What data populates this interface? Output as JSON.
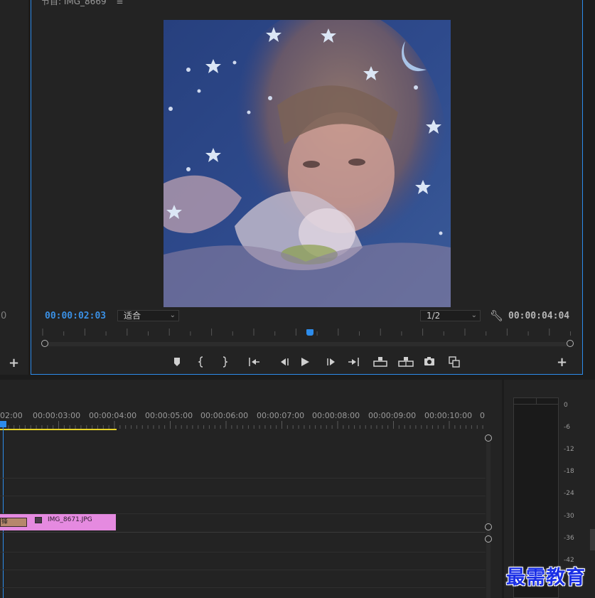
{
  "monitor": {
    "title": "节目: IMG_8669",
    "menu_icon": "hamburger-icon",
    "current_timecode": "00:00:02:03",
    "fit_select": "适合",
    "resolution_select": "1/2",
    "duration_timecode": "00:00:04:04",
    "settings_icon": "wrench-icon",
    "buttons": [
      {
        "name": "add-marker",
        "icon": "marker-icon"
      },
      {
        "name": "mark-in",
        "icon": "mark-in-icon"
      },
      {
        "name": "mark-out",
        "icon": "mark-out-icon"
      },
      {
        "name": "go-to-in",
        "icon": "go-to-in-icon"
      },
      {
        "name": "step-back",
        "icon": "step-back-icon"
      },
      {
        "name": "play",
        "icon": "play-icon"
      },
      {
        "name": "step-forward",
        "icon": "step-forward-icon"
      },
      {
        "name": "go-to-out",
        "icon": "go-to-out-icon"
      },
      {
        "name": "lift",
        "icon": "lift-icon"
      },
      {
        "name": "extract",
        "icon": "extract-icon"
      },
      {
        "name": "export-frame",
        "icon": "camera-icon"
      },
      {
        "name": "comparison-view",
        "icon": "comparison-icon"
      }
    ],
    "playhead_fraction": 0.495
  },
  "left_panel": {
    "edge_value": "0"
  },
  "timeline": {
    "ruler_labels": [
      "02:00",
      "00:00:03:00",
      "00:00:04:00",
      "00:00:05:00",
      "00:00:06:00",
      "00:00:07:00",
      "00:00:08:00",
      "00:00:09:00",
      "00:00:10:00",
      "0"
    ],
    "clip_label": "IMG_8671.JPG",
    "prev_clip_label": "锋"
  },
  "meter": {
    "db_scale": [
      "0",
      "-6",
      "-12",
      "-18",
      "-24",
      "-30",
      "-36",
      "-42"
    ]
  },
  "watermark": "最需教育",
  "colors": {
    "accent": "#2d8ceb",
    "clip": "#e58ae0",
    "work_area": "#e6d22a",
    "timecode_blue": "#3a8fe3"
  }
}
